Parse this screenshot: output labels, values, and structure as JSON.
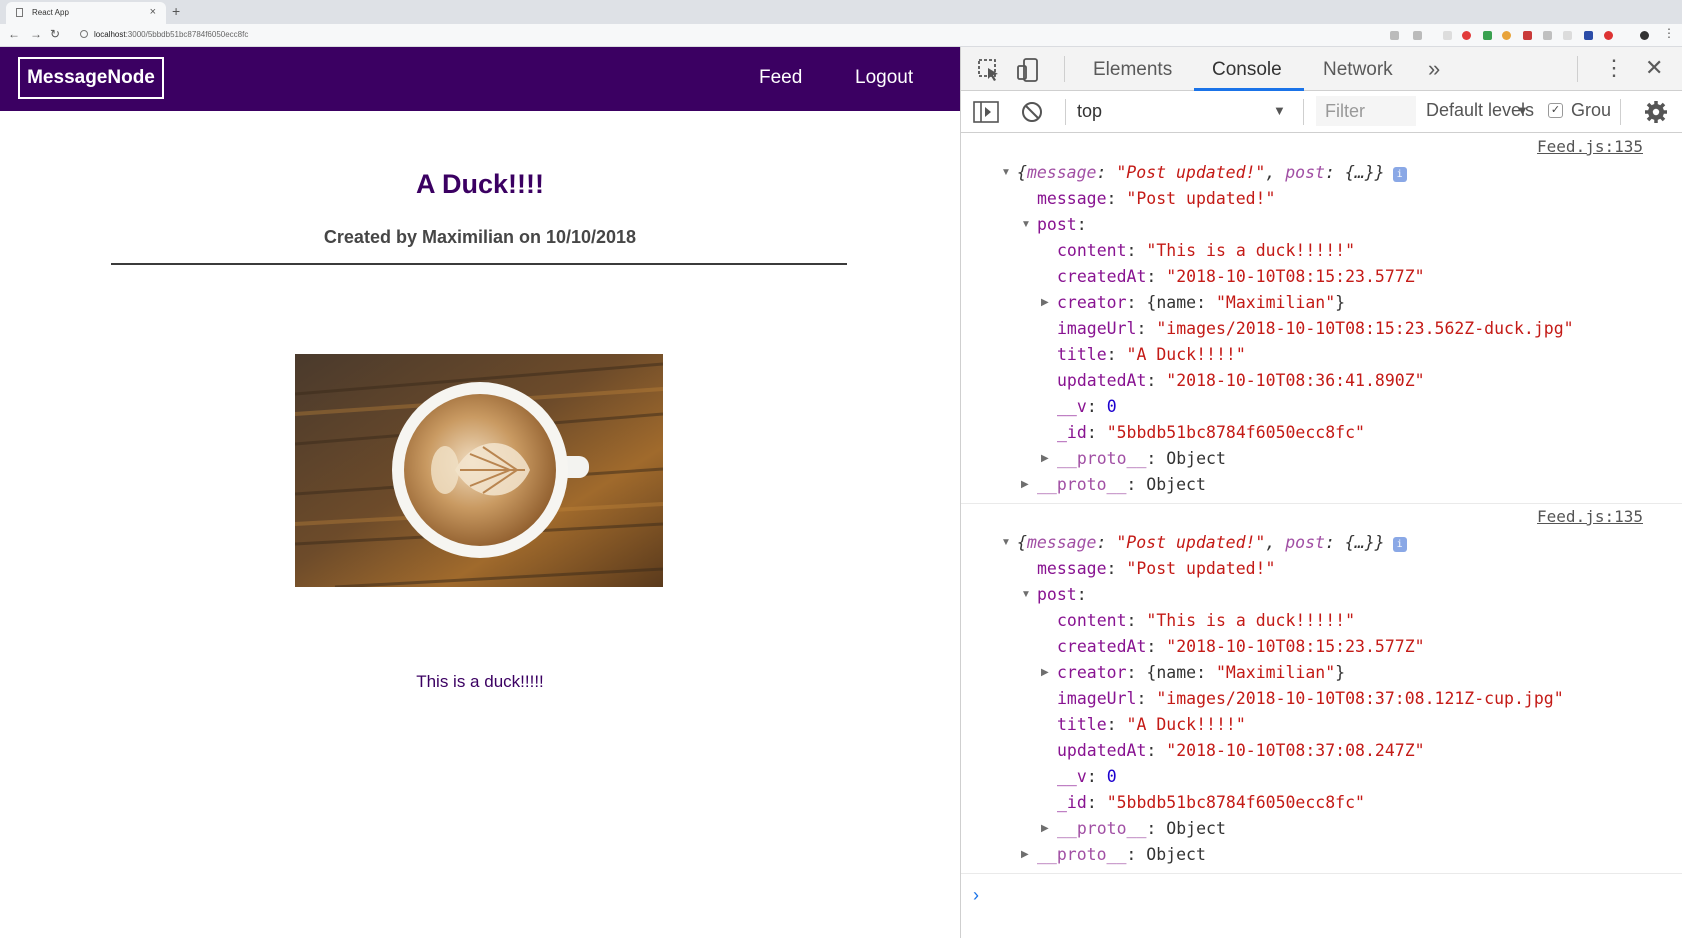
{
  "browser": {
    "tab_title": "React App",
    "url_host": "localhost",
    "url_path": ":3000/5bbdb51bc8784f6050ecc8fc"
  },
  "app": {
    "brand": "MessageNode",
    "nav": {
      "feed": "Feed",
      "logout": "Logout"
    },
    "post": {
      "title": "A Duck!!!!",
      "meta": "Created by Maximilian on 10/10/2018",
      "content": "This is a duck!!!!!"
    }
  },
  "devtools": {
    "tabs": [
      "Elements",
      "Console",
      "Network"
    ],
    "more_tabs": "»",
    "context": "top",
    "filter_placeholder": "Filter",
    "levels": "Default levels",
    "group_label": "Group",
    "log_entries": [
      {
        "source": "Feed.js:135",
        "summary_message": "\"Post updated!\"",
        "message": "\"Post updated!\"",
        "content": "\"This is a duck!!!!!\"",
        "createdAt": "\"2018-10-10T08:15:23.577Z\"",
        "creator_name": "\"Maximilian\"",
        "imageUrl": "\"images/2018-10-10T08:15:23.562Z-duck.jpg\"",
        "title": "\"A Duck!!!!\"",
        "updatedAt": "\"2018-10-10T08:36:41.890Z\"",
        "v": "0",
        "id": "\"5bbdb51bc8784f6050ecc8fc\""
      },
      {
        "source": "Feed.js:135",
        "summary_message": "\"Post updated!\"",
        "message": "\"Post updated!\"",
        "content": "\"This is a duck!!!!!\"",
        "createdAt": "\"2018-10-10T08:15:23.577Z\"",
        "creator_name": "\"Maximilian\"",
        "imageUrl": "\"images/2018-10-10T08:37:08.121Z-cup.jpg\"",
        "title": "\"A Duck!!!!\"",
        "updatedAt": "\"2018-10-10T08:37:08.247Z\"",
        "v": "0",
        "id": "\"5bbdb51bc8784f6050ecc8fc\""
      }
    ],
    "prompt": "›"
  },
  "colors": {
    "app_header": "#3b0062",
    "console_key": "#881391",
    "console_string": "#c41a16",
    "console_number": "#1c00cf",
    "active_tab_underline": "#1a73e8"
  }
}
